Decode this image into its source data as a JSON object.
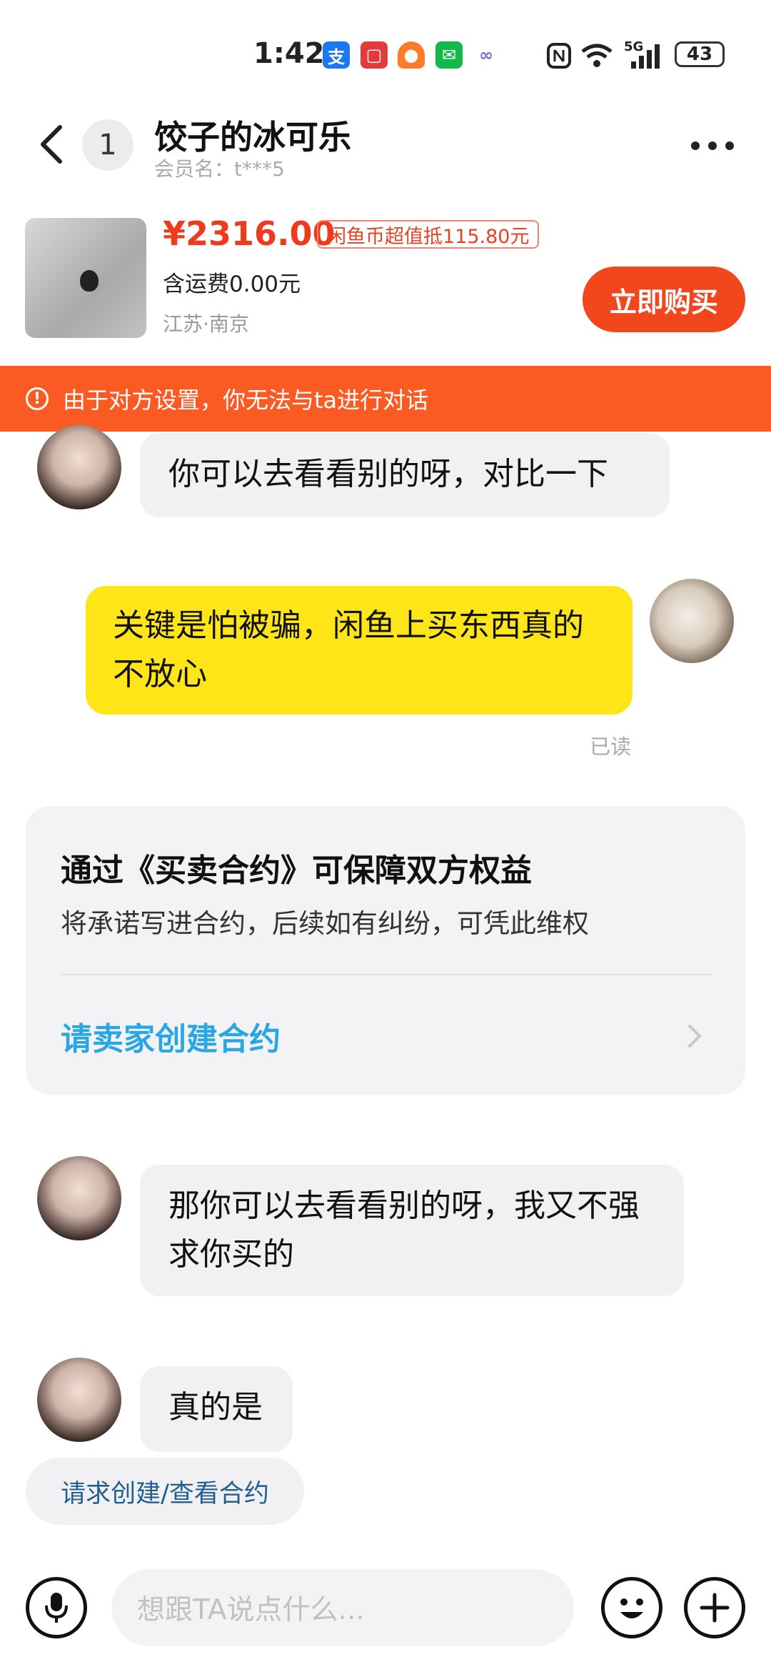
{
  "status_bar": {
    "time": "1:42",
    "network": "5G",
    "battery": "43",
    "app_icons": [
      "alipay-icon",
      "book-icon",
      "bell-icon",
      "wechat-icon",
      "link-icon"
    ]
  },
  "header": {
    "back_icon": "chevron-left-icon",
    "unread_count": "1",
    "title": "饺子的冰可乐",
    "member_name": "会员名：t***5",
    "more_icon": "more-dots-icon"
  },
  "product": {
    "price": "¥2316.00",
    "coin_badge": "闲鱼币超值抵115.80元",
    "shipping": "含运费0.00元",
    "location": "江苏·南京",
    "buy_button": "立即购买"
  },
  "warning": {
    "text": "由于对方设置，你无法与ta进行对话"
  },
  "messages": [
    {
      "side": "left",
      "text": "你可以去看看别的呀，对比一下"
    },
    {
      "side": "right",
      "text": "关键是怕被骗，闲鱼上买东西真的不放心",
      "status": "已读"
    },
    {
      "side": "left",
      "text": "那你可以去看看别的呀，我又不强求你买的"
    },
    {
      "side": "left",
      "text": "真的是"
    }
  ],
  "contract_card": {
    "title": "通过《买卖合约》可保障双方权益",
    "subtitle": "将承诺写进合约，后续如有纠纷，可凭此维权",
    "link": "请卖家创建合约"
  },
  "quick_action": {
    "label": "请求创建/查看合约"
  },
  "input_bar": {
    "placeholder": "想跟TA说点什么...",
    "mic_icon": "microphone-icon",
    "emoji_icon": "emoji-icon",
    "plus_icon": "plus-icon"
  },
  "colors": {
    "accent": "#f2461d",
    "warning_bg": "#fb5a22",
    "my_bubble": "#fde517",
    "link": "#2ba6e5"
  }
}
